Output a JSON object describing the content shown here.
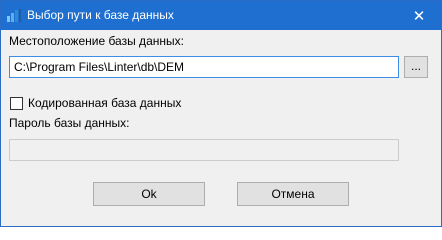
{
  "window": {
    "title": "Выбор пути к базе данных",
    "close_glyph": "✕",
    "accent": "#1f6fd0"
  },
  "form": {
    "location_label": "Местоположение базы данных:",
    "location_value": "C:\\Program Files\\Linter\\db\\DEM",
    "browse_label": "...",
    "encrypted_checkbox": {
      "label": "Кодированная база данных",
      "checked": false
    },
    "password_label": "Пароль базы данных:",
    "password_value": ""
  },
  "buttons": {
    "ok": "Ok",
    "cancel": "Отмена"
  }
}
